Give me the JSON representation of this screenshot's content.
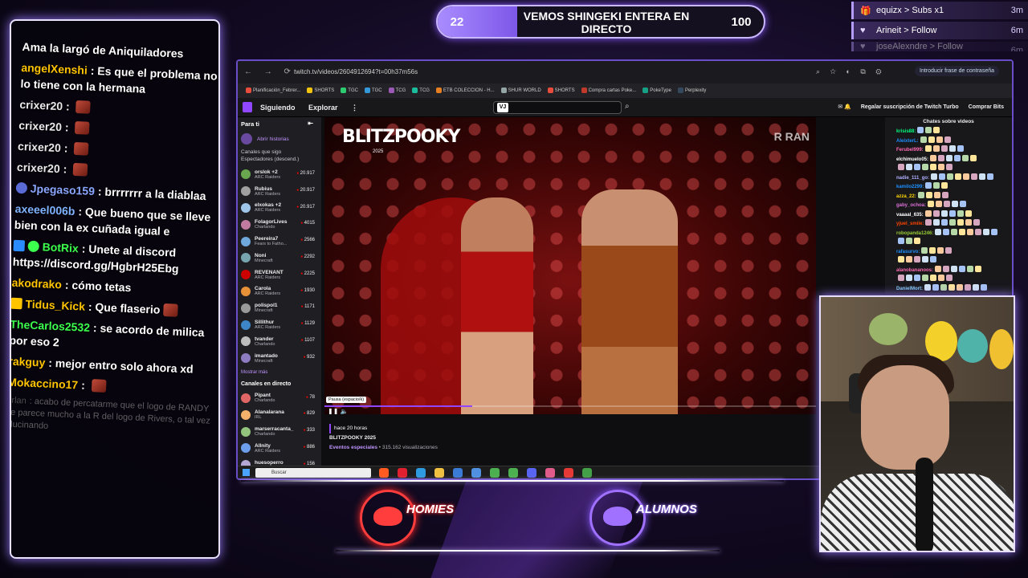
{
  "goal": {
    "current": "22",
    "target": "100",
    "title": "VEMOS SHINGEKI ENTERA EN DIRECTO",
    "progress_fraction": 0.22
  },
  "events": [
    {
      "icon": "gift-icon",
      "text": "equizx > Subs x1",
      "time": "3m"
    },
    {
      "icon": "heart-icon",
      "text": "Arineit > Follow",
      "time": "6m"
    },
    {
      "icon": "heart-icon",
      "text": "joseAlexndre > Follow",
      "time": "6m"
    }
  ],
  "chat": {
    "messages": [
      {
        "user": "",
        "color": "#ffffff",
        "text": "Ama la largó de Aniquiladores"
      },
      {
        "user": "angelXenshi",
        "color": "#ffc400",
        "text": "Es que el problema no lo tiene con la hermana"
      },
      {
        "user": "crixer20",
        "color": "#e8e8e8",
        "text": "",
        "emote": true
      },
      {
        "user": "crixer20",
        "color": "#e8e8e8",
        "text": "",
        "emote": true
      },
      {
        "user": "crixer20",
        "color": "#e8e8e8",
        "text": "",
        "emote": true
      },
      {
        "user": "crixer20",
        "color": "#e8e8e8",
        "text": "",
        "emote": true
      },
      {
        "user": "Jpegaso159",
        "color": "#8aa6ff",
        "text": "brrrrrrr a la diablaa"
      },
      {
        "user": "axeeel006b",
        "color": "#7fb3ff",
        "text": "Que bueno que se lleve bien con la ex cuñada igual e"
      },
      {
        "user": "BotRix",
        "color": "#3cff4e",
        "text": "Unete al discord https://discord.gg/HgbrH25Ebg"
      },
      {
        "user": "akodrako",
        "color": "#ffc400",
        "text": "cómo tetas"
      },
      {
        "user": "Tidus_Kick",
        "color": "#ffc400",
        "text": "Que flaserio"
      },
      {
        "user": "TheCarlos2532",
        "color": "#3cff4e",
        "text": "se acordo de milica por eso 2"
      },
      {
        "user": "rakguy",
        "color": "#ffc400",
        "text": "mejor entro solo ahora xd"
      },
      {
        "user": "Mokaccino17",
        "color": "#ffc400",
        "text": "",
        "emote": true
      },
      {
        "user": "0rlan",
        "color": "#cccccc",
        "text": "acabo de percatarme que el logo de RANDY se parece mucho a la R del logo de Rivers, o tal vez alucinando"
      }
    ]
  },
  "browser": {
    "url": "twitch.tv/videos/2604912694?t=00h37m56s",
    "translate": "Introducir frase de contraseña",
    "bookmarks": [
      "Planificación_Febrer...",
      "SHORTS",
      "TGC",
      "TGC",
      "TCG",
      "TCG",
      "ETB COLECCION - H...",
      "SHUR WORLD",
      "SHORTS",
      "Compra cartas Poke...",
      "PokeType",
      "Perplexity"
    ]
  },
  "twitch": {
    "nav": [
      "Siguiendo",
      "Explorar"
    ],
    "search_logo": "VJ",
    "turbo": "Regalar suscripción de Twitch Turbo",
    "bits": "Comprar Bits",
    "sidebar": {
      "for_you": "Para ti",
      "history": "Abrir historias",
      "subtitle1": "Canales que sigo",
      "subtitle2": "Espectadores (descend.)",
      "channels": [
        {
          "name": "orslok +2",
          "game": "ARC Raiders",
          "viewers": "20.917",
          "color": "#6aa84f"
        },
        {
          "name": "Rubius",
          "game": "ARC Raiders",
          "viewers": "20.917",
          "color": "#a0a0a0"
        },
        {
          "name": "elxokas +2",
          "game": "ARC Raiders",
          "viewers": "20.917",
          "color": "#9fc5e8"
        },
        {
          "name": "FolagorLives",
          "game": "Charlando",
          "viewers": "4015",
          "color": "#c27ba0"
        },
        {
          "name": "Peereira7",
          "game": "Fears to Fatho...",
          "viewers": "2566",
          "color": "#6fa8dc"
        },
        {
          "name": "Noni",
          "game": "Minecraft",
          "viewers": "2292",
          "color": "#76a5af"
        },
        {
          "name": "REVENANT",
          "game": "ARC Raiders",
          "viewers": "2225",
          "color": "#cc0000"
        },
        {
          "name": "Carola",
          "game": "ARC Raiders",
          "viewers": "1930",
          "color": "#e69138"
        },
        {
          "name": "polispol1",
          "game": "Minecraft",
          "viewers": "1171",
          "color": "#999999"
        },
        {
          "name": "Sillithur",
          "game": "ARC Raiders",
          "viewers": "1129",
          "color": "#3d85c6"
        },
        {
          "name": "tvander",
          "game": "Charlando",
          "viewers": "1107",
          "color": "#bcbcbc"
        },
        {
          "name": "imantado",
          "game": "Minecraft",
          "viewers": "932",
          "color": "#8e7cc3"
        }
      ],
      "show_more": "Mostrar más",
      "live_heading": "Canales en directo",
      "live": [
        {
          "name": "Pipant",
          "game": "Charlando",
          "viewers": "78",
          "color": "#e06666"
        },
        {
          "name": "Alanalarana",
          "game": "IRL",
          "viewers": "829",
          "color": "#f6b26b"
        },
        {
          "name": "marserracanta_",
          "game": "Charlando",
          "viewers": "333",
          "color": "#93c47d"
        },
        {
          "name": "Allnity",
          "game": "ARC Raiders",
          "viewers": "886",
          "color": "#6d9eeb"
        },
        {
          "name": "huesoperro",
          "game": "Human Fall Flat",
          "viewers": "156",
          "color": "#b4a7d6"
        }
      ]
    },
    "player": {
      "title": "BLITZPOOKY",
      "year": "2025",
      "corner_logo": "R RAN",
      "tooltip": "Pausa (espacio/k)",
      "progress_fraction": 0.3
    },
    "video": {
      "ago": "hace 20 horas",
      "title": "BLITZPOOKY 2025",
      "category": "Eventos especiales",
      "views": " • 315.162 visualizaciones"
    },
    "chat_header": "Chates sobre videos",
    "chat_lines": [
      {
        "user": "krisis88:",
        "color": "#00ff7f"
      },
      {
        "user": "AleixterL:",
        "color": "#1e90ff"
      },
      {
        "user": "Ferubel999:",
        "color": "#ff69b4"
      },
      {
        "user": "elchimuelo05:",
        "color": "#ffffff"
      },
      {
        "user": "",
        "color": "#ffffff"
      },
      {
        "user": "nadie_111_go:",
        "color": "#b0b0ff"
      },
      {
        "user": "kamilo2299:",
        "color": "#1e90ff"
      },
      {
        "user": "azza_22:",
        "color": "#ffd700"
      },
      {
        "user": "gaby_ochoa:",
        "color": "#da70d6"
      },
      {
        "user": "vaaaal_635:",
        "color": "#ffffff"
      },
      {
        "user": "yjuel_smile:",
        "color": "#ff4500"
      },
      {
        "user": "robopanda1246:",
        "color": "#9acd32"
      },
      {
        "user": "",
        "color": "#ffffff"
      },
      {
        "user": "rafasurvo:",
        "color": "#1e90ff"
      },
      {
        "user": "",
        "color": "#ffffff"
      },
      {
        "user": "alanobananoos:",
        "color": "#ff69b4"
      },
      {
        "user": "",
        "color": "#ffffff"
      },
      {
        "user": "DanielMort:",
        "color": "#87cefa"
      }
    ],
    "taskbar_search": "Buscar"
  },
  "logos": {
    "left": "HOMIES",
    "right": "ALUMNOS"
  }
}
